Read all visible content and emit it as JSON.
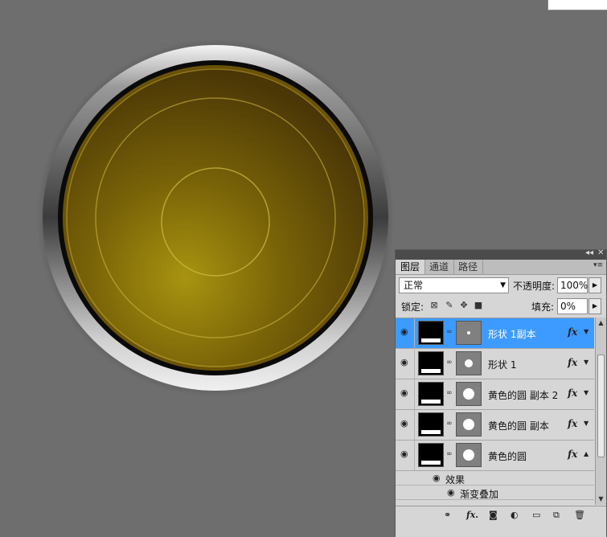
{
  "panel": {
    "tabs": [
      {
        "label": "图层"
      },
      {
        "label": "通道"
      },
      {
        "label": "路径"
      }
    ],
    "blend_mode": "正常",
    "opacity_label": "不透明度:",
    "opacity_value": "100%",
    "lock_label": "锁定:",
    "fill_label": "填充:",
    "fill_value": "0%",
    "layers": [
      {
        "name": "形状 1副本",
        "selected": true,
        "fx": "fx"
      },
      {
        "name": "形状 1",
        "selected": false,
        "fx": "fx"
      },
      {
        "name": "黄色的圆 副本 2",
        "selected": false,
        "fx": "fx"
      },
      {
        "name": "黄色的圆 副本",
        "selected": false,
        "fx": "fx"
      },
      {
        "name": "黄色的圆",
        "selected": false,
        "fx": "fx"
      }
    ],
    "effects_label": "效果",
    "effect_items": [
      "渐变叠加"
    ],
    "bottom_fx": "fx."
  },
  "colors": {
    "selected_row": "#3d9bff",
    "canvas_bg": "#6e6e6e",
    "button_gold": "#a08a10"
  }
}
